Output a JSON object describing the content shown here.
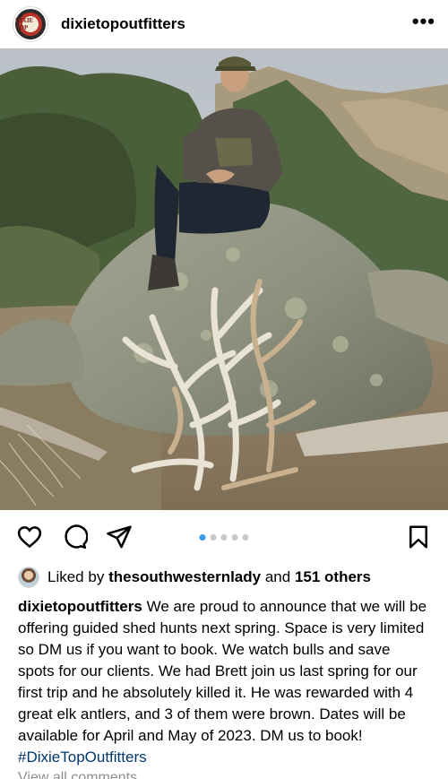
{
  "post": {
    "username": "dixietopoutfitters",
    "avatar_text": "DIXIE TOP",
    "more_icon": "more-horizontal-icon",
    "image_alt": "Hunter sitting on a large boulder with elk shed antlers leaning against it",
    "carousel": {
      "count": 5,
      "active_index": 0
    },
    "likes": {
      "prefix": "Liked by",
      "user": "thesouthwesternlady",
      "conjunction": "and",
      "others": "151 others"
    },
    "caption": {
      "username": "dixietopoutfitters",
      "text": "We are proud to announce that we will be offering guided shed hunts next spring. Space is very limited so DM us if you want to book. We watch bulls and save spots for our clients. We had Brett join us last spring for our first trip and he absolutely killed it. He was rewarded with 4 great elk antlers, and 3 of them were brown. Dates will be available for April and May of 2023. DM us to book!",
      "hashtag": "#DixieTopOutfitters"
    },
    "view_comments": "View all comments"
  },
  "colors": {
    "accent": "#3897f0",
    "hashtag": "#00376b",
    "muted": "#8e8e8e"
  }
}
